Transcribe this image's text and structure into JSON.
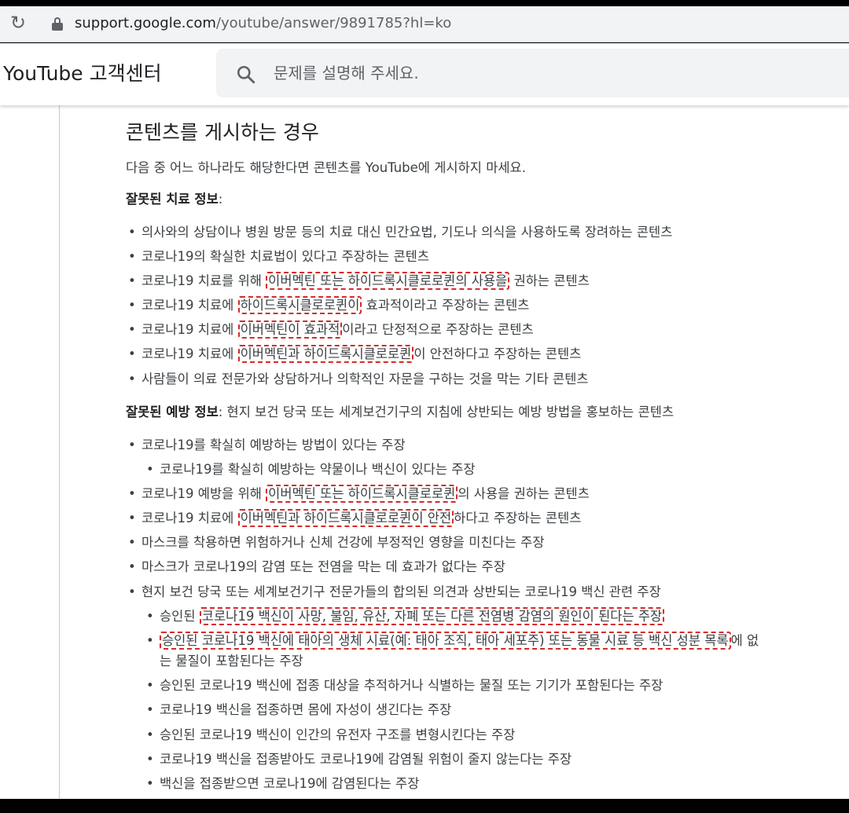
{
  "browser": {
    "url_host": "support.google.com",
    "url_path": "/youtube/answer/9891785?hl=ko"
  },
  "header": {
    "title": "YouTube 고객센터",
    "search_placeholder": "문제를 설명해 주세요."
  },
  "article": {
    "heading": "콘텐츠를 게시하는 경우",
    "intro": "다음 중 어느 하나라도 해당한다면 콘텐츠를 YouTube에 게시하지 마세요.",
    "treatment_label": "잘못된 치료 정보",
    "treatment_colon": ":",
    "treatment_items": [
      {
        "a": "의사와의 상담이나 병원 방문 등의 치료 대신 민간요법, 기도나 의식을 사용하도록 장려하는 콘텐츠",
        "b": "",
        "c": ""
      },
      {
        "a": "코로나19의 확실한 치료법이 있다고 주장하는 콘텐츠",
        "b": "",
        "c": ""
      },
      {
        "a": "코로나19 치료를 위해 ",
        "b": "이버멕틴 또는 하이드록시클로로퀸의 사용을",
        "c": " 권하는 콘텐츠"
      },
      {
        "a": "코로나19 치료에 ",
        "b": "하이드록시클로로퀸이",
        "c": " 효과적이라고 주장하는 콘텐츠"
      },
      {
        "a": "코로나19 치료에 ",
        "b": "이버멕틴이 효과적",
        "c": "이라고 단정적으로 주장하는 콘텐츠"
      },
      {
        "a": "코로나19 치료에 ",
        "b": "이버멕틴과 하이드록시클로로퀸",
        "c": "이 안전하다고 주장하는 콘텐츠"
      },
      {
        "a": "사람들이 의료 전문가와 상담하거나 의학적인 자문을 구하는 것을 막는 기타 콘텐츠",
        "b": "",
        "c": ""
      }
    ],
    "prevention_label": "잘못된 예방 정보",
    "prevention_text": ": 현지 보건 당국 또는 세계보건기구의 지침에 상반되는 예방 방법을 홍보하는 콘텐츠",
    "prevention_items": [
      {
        "a": "코로나19를 확실히 예방하는 방법이 있다는 주장",
        "b": "",
        "c": ""
      },
      {
        "a": "코로나19를 확실히 예방하는 약물이나 백신이 있다는 주장",
        "b": "",
        "c": ""
      },
      {
        "a": "코로나19 예방을 위해 ",
        "b": "이버멕틴 또는 하이드록시클로로퀸",
        "c": "의 사용을 권하는 콘텐츠"
      },
      {
        "a": "코로나19 치료에 ",
        "b": "이버멕틴과 하이드록시클로로퀸이 안전",
        "c": "하다고 주장하는 콘텐츠"
      },
      {
        "a": "마스크를 착용하면 위험하거나 신체 건강에 부정적인 영향을 미친다는 주장",
        "b": "",
        "c": ""
      },
      {
        "a": "마스크가 코로나19의 감염 또는 전염을 막는 데 효과가 없다는 주장",
        "b": "",
        "c": ""
      },
      {
        "a": "현지 보건 당국 또는 세계보건기구 전문가들의 합의된 의견과 상반되는 코로나19 백신 관련 주장",
        "b": "",
        "c": ""
      },
      {
        "a": "승인된 ",
        "b": "코로나19 백신이 사망, 불임, 유산, 자폐 또는 다른 전염병 감염의 원인이 된다는 주장",
        "c": ""
      },
      {
        "a": "",
        "b": "승인된 코로나19 백신에 태아의 생체 시료(예: 태아 조직, 태아 세포주) 또는 동물 시료 등 백신 성분 목록",
        "c": "에 없"
      },
      {
        "a": "승인된 코로나19 백신에 접종 대상을 추적하거나 식별하는 물질 또는 기기가 포함된다는 주장",
        "b": "",
        "c": ""
      },
      {
        "a": "코로나19 백신을 접종하면 몸에 자성이 생긴다는 주장",
        "b": "",
        "c": ""
      },
      {
        "a": "승인된 코로나19 백신이 인간의 유전자 구조를 변형시킨다는 주장",
        "b": "",
        "c": ""
      },
      {
        "a": "코로나19 백신을 접종받아도 코로나19에 감염될 위험이 줄지 않는다는 주장",
        "b": "",
        "c": ""
      },
      {
        "a": "백신을 접종받으면 코로나19에 감염된다는 주장",
        "b": "",
        "c": ""
      }
    ],
    "prevention_wrap_line": "는 물질이 포함된다는 주장"
  },
  "colors": {
    "highlight_border": "#d62a2a",
    "text": "#3c4043",
    "header_bg": "#f1f3f4"
  },
  "icons": [
    "reload-icon",
    "lock-icon",
    "search-icon"
  ]
}
